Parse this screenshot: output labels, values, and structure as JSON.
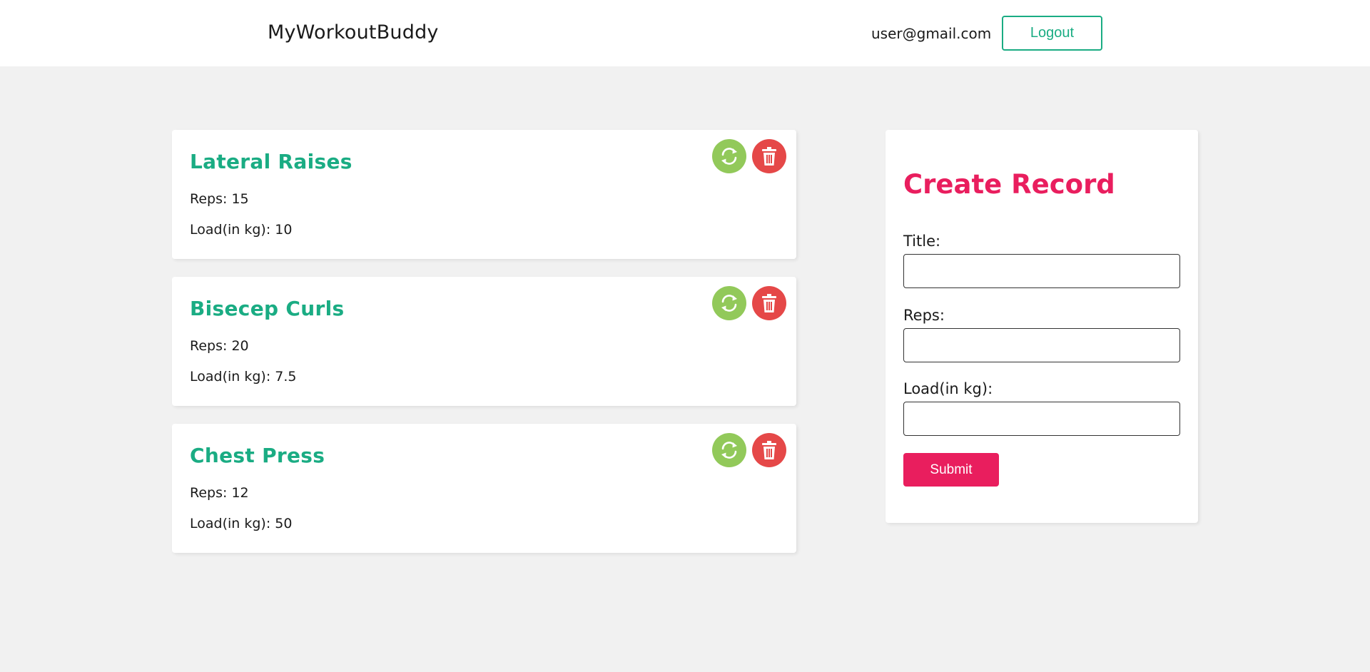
{
  "header": {
    "brand": "MyWorkoutBuddy",
    "user_email": "user@gmail.com",
    "logout_label": "Logout"
  },
  "workouts": [
    {
      "title": "Lateral Raises",
      "reps": "Reps: 15",
      "load": "Load(in kg): 10"
    },
    {
      "title": "Bisecep Curls",
      "reps": "Reps: 20",
      "load": "Load(in kg): 7.5"
    },
    {
      "title": "Chest Press",
      "reps": "Reps: 12",
      "load": "Load(in kg): 50"
    }
  ],
  "workout_actions": {
    "update_icon": "refresh-icon",
    "delete_icon": "trash-icon"
  },
  "form": {
    "title": "Create Record",
    "title_label": "Title:",
    "title_value": "",
    "reps_label": "Reps:",
    "reps_value": "",
    "load_label": "Load(in kg):",
    "load_value": "",
    "submit_label": "Submit"
  },
  "colors": {
    "accent_green": "#1aac83",
    "accent_pink": "#e91e5e",
    "update_button": "#92c95a",
    "delete_button": "#e54848",
    "background": "#f1f1f1"
  }
}
